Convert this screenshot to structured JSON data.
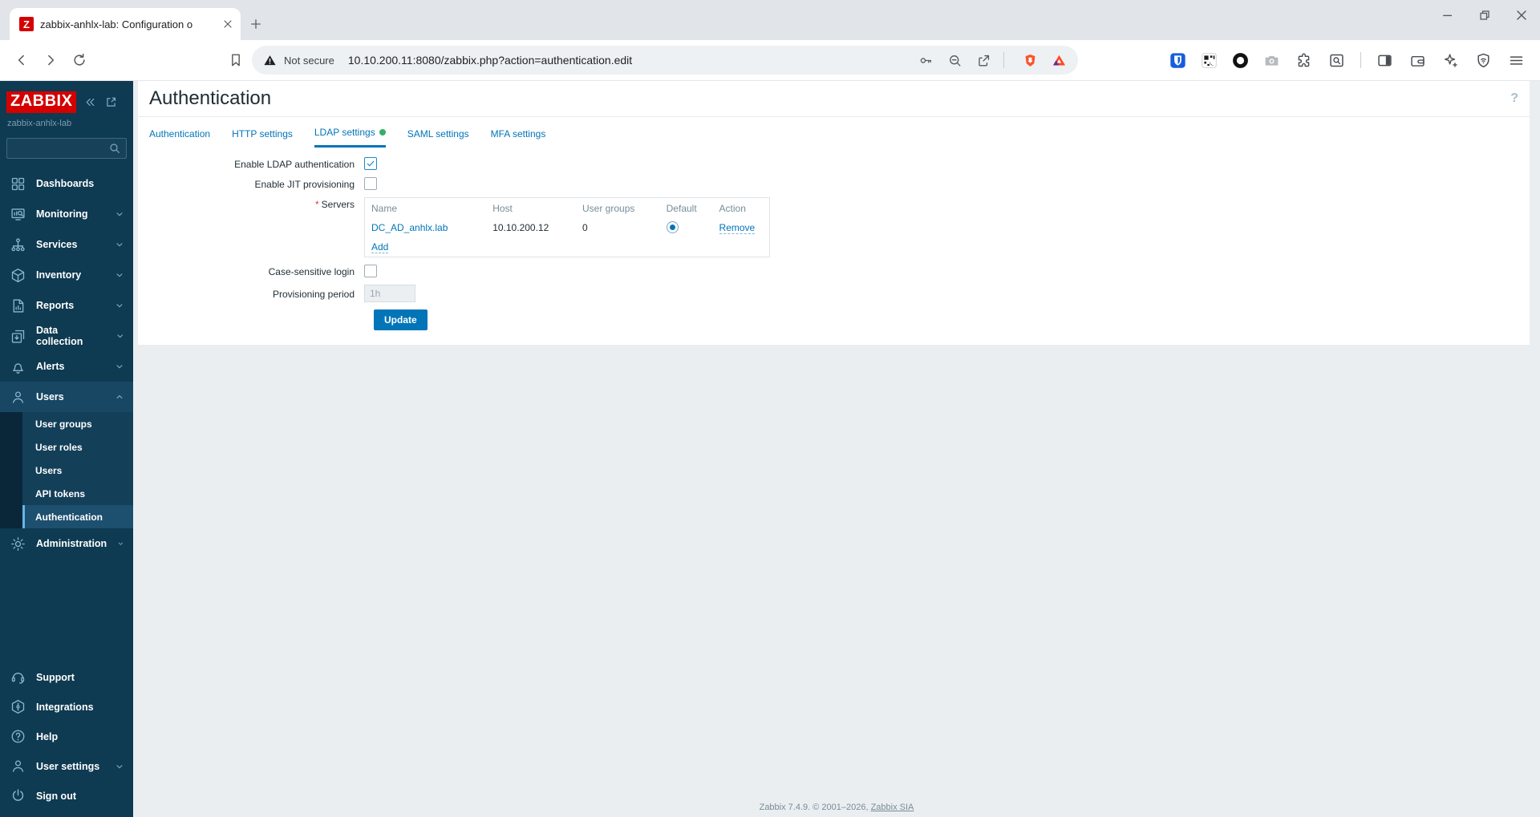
{
  "browser": {
    "favicon_letter": "Z",
    "tab_title": "zabbix-anhlx-lab: Configuration o",
    "security_label": "Not secure",
    "url": "10.10.200.11:8080/zabbix.php?action=authentication.edit"
  },
  "sidebar": {
    "logo_text": "ZABBIX",
    "server_name": "zabbix-anhlx-lab",
    "menu": [
      {
        "label": "Dashboards"
      },
      {
        "label": "Monitoring"
      },
      {
        "label": "Services"
      },
      {
        "label": "Inventory"
      },
      {
        "label": "Reports"
      },
      {
        "label": "Data collection"
      },
      {
        "label": "Alerts"
      },
      {
        "label": "Users"
      },
      {
        "label": "Administration"
      }
    ],
    "users_submenu": [
      {
        "label": "User groups"
      },
      {
        "label": "User roles"
      },
      {
        "label": "Users"
      },
      {
        "label": "API tokens"
      },
      {
        "label": "Authentication"
      }
    ],
    "footer_menu": [
      {
        "label": "Support"
      },
      {
        "label": "Integrations"
      },
      {
        "label": "Help"
      },
      {
        "label": "User settings"
      },
      {
        "label": "Sign out"
      }
    ]
  },
  "page": {
    "title": "Authentication",
    "help_glyph": "?"
  },
  "tabs": [
    {
      "label": "Authentication"
    },
    {
      "label": "HTTP settings"
    },
    {
      "label": "LDAP settings"
    },
    {
      "label": "SAML settings"
    },
    {
      "label": "MFA settings"
    }
  ],
  "form": {
    "required_mark": "*",
    "enable_ldap_label": "Enable LDAP authentication",
    "enable_jit_label": "Enable JIT provisioning",
    "servers_label": "Servers",
    "case_sensitive_label": "Case-sensitive login",
    "provisioning_label": "Provisioning period",
    "provisioning_value": "1h",
    "update_button": "Update",
    "servers_table": {
      "headers": [
        "Name",
        "Host",
        "User groups",
        "Default",
        "Action"
      ],
      "rows": [
        {
          "name": "DC_AD_anhlx.lab",
          "host": "10.10.200.12",
          "user_groups": "0",
          "action": "Remove"
        }
      ],
      "add_label": "Add"
    }
  },
  "footer": {
    "text": "Zabbix 7.4.9. © 2001–2026, ",
    "link": "Zabbix SIA"
  },
  "colors": {
    "accent_blue": "#0275b8",
    "sidebar_bg": "#0e3a52",
    "logo_red": "#d40000",
    "tab_green_dot": "#34af67"
  }
}
